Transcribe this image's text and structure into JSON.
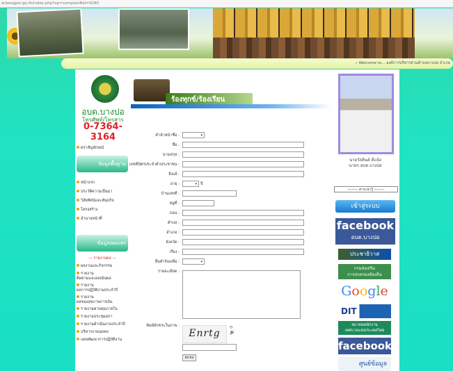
{
  "url": "w.bangpor.go.th/index.php?op=complainBid=9280",
  "welcome": ":: Welcome to... องค์การบริหารส่วนตำบลบางปอ อำเภอ",
  "left": {
    "org_name": "อบต.บางปอ",
    "tel_label": "โทรศัพท์/โทรสาร",
    "tel": "0-7364-3164",
    "menu_top": [
      "ตราสัญลักษณ์"
    ],
    "banner1": "ข้อมูลพื้นฐาน",
    "menu_mid": [
      "หน้าแรก",
      "ประวัติความเป็นมา",
      "วิสัยทัศน์และพันธกิจ",
      "โครงสร้าง",
      "อำนาจหน้าที่"
    ],
    "banner2": "ข้อมูลเผยแพร่",
    "section_title": "— รายงานผล —",
    "menu_bottom": [
      "ผลงานและกิจกรรม",
      "รายงาน\nติดตามและผลเมินผล",
      "รายงาน\nผลการปฏิบัติงานประจำปี",
      "รายงาน\nผลของสุขภาพการเงิน",
      "รายงานควบคุมภายใน",
      "รายงานประชุมสภา",
      "รายงานดำเนินงานประจำปี",
      "บริหารงานบุคคล",
      "แผนพัฒนาการปฏิบัติงาน"
    ]
  },
  "main": {
    "title": "ร้องทุกข์/ร้องเรียน",
    "fields": [
      {
        "label": "คำนำหน้าชื่อ :",
        "type": "select",
        "value": ""
      },
      {
        "label": "ชื่อ :",
        "type": "text"
      },
      {
        "label": "นามสกุล :",
        "type": "text"
      },
      {
        "label": "เลขที่บัตรประจำตัวประชาชน :",
        "type": "text"
      },
      {
        "label": "อีเมล์ :",
        "type": "text"
      },
      {
        "label": "อายุ :",
        "type": "select-age",
        "unit": "ปี"
      },
      {
        "label": "บ้านเลขที่ :",
        "type": "short"
      },
      {
        "label": "หมู่ที่ :",
        "type": "tiny"
      },
      {
        "label": "ถนน :",
        "type": "text"
      },
      {
        "label": "ตำบล :",
        "type": "text"
      },
      {
        "label": "อำเภอ :",
        "type": "text"
      },
      {
        "label": "จังหวัด :",
        "type": "text"
      },
      {
        "label": "เรื่อง :",
        "type": "text"
      },
      {
        "label": "ยื่นคำร้องเพื่อ :",
        "type": "select",
        "value": ""
      },
      {
        "label": "รายละเอียด :",
        "type": "none"
      }
    ],
    "captcha_label": "พิมพ์อักขระในภาพ :",
    "captcha_text": "Enrtg",
    "submit": "ตกลง"
  },
  "right": {
    "name_line1": "นายวัลลินต์ ดีแจ้ง",
    "name_line2": "นายก อบต.บางปอ",
    "select": "——— สาระน่ารู้ ———",
    "login": "เข้าสู่ระบบ",
    "facebook": "facebook",
    "facebook_sub": "อบต.บางปอ",
    "pracha": "ประชาธิวาส",
    "dept_line1": "กรมส่งเสริม",
    "dept_line2": "การปกครองท้องถิ่น",
    "google": "Google",
    "dit": "DIT",
    "assoc_line1": "สมาคมพนักงาน",
    "assoc_line2": "เทศบาลแห่งประเทศไทย",
    "facebook2": "facebook",
    "last": "ศูนย์ข้อมูล"
  }
}
